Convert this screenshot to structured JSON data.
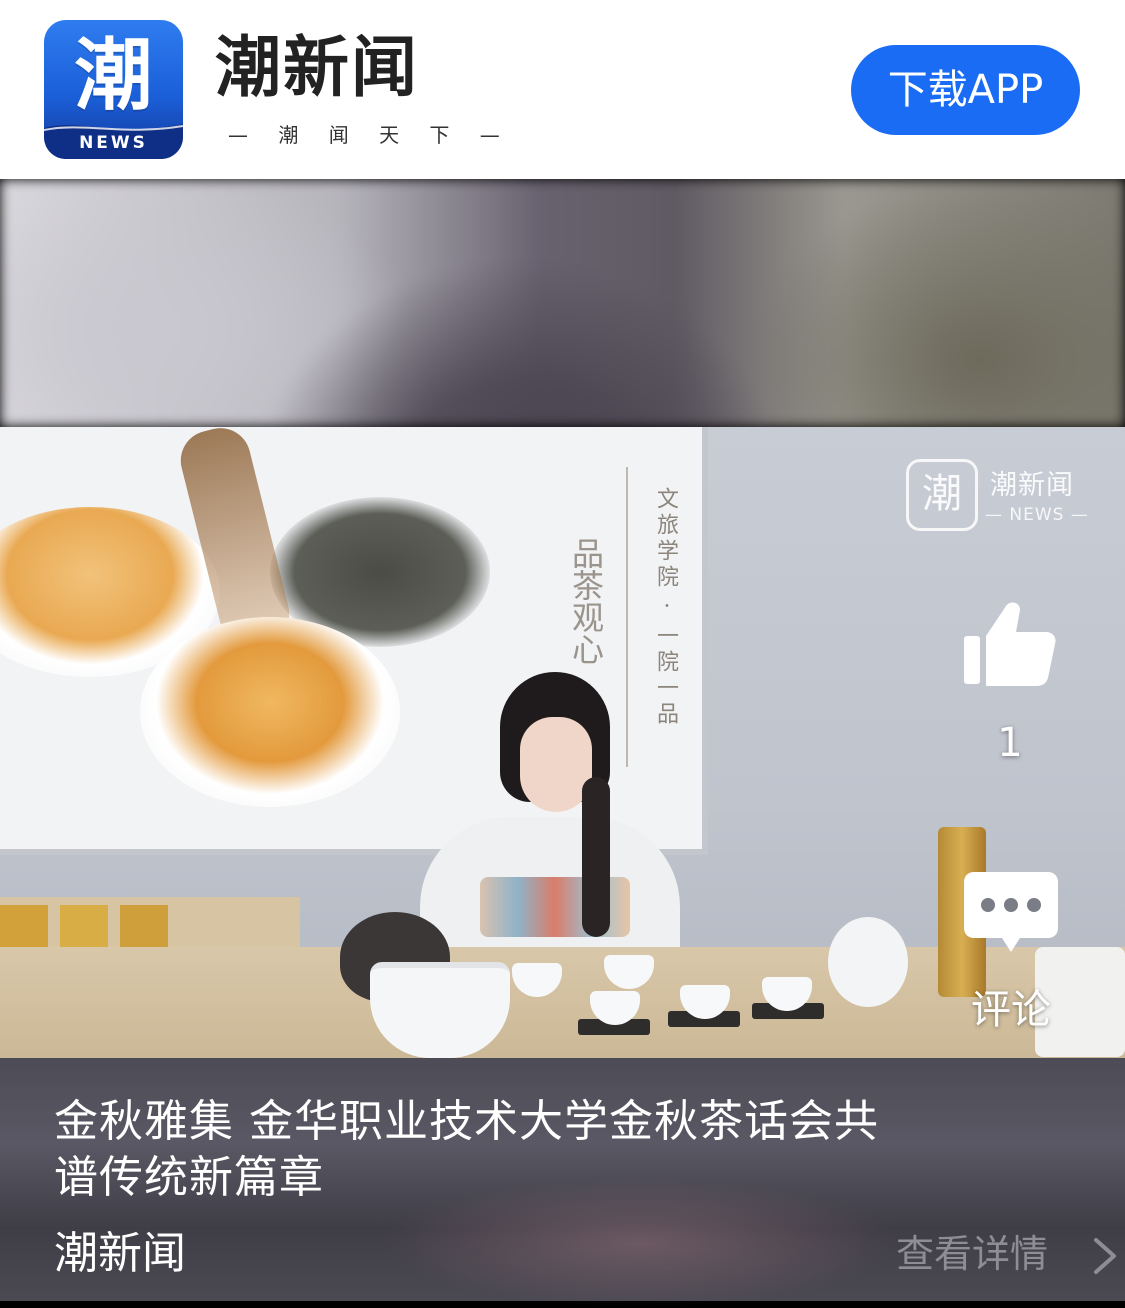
{
  "header": {
    "logo_char": "潮",
    "logo_sub": "NEWS",
    "app_name": "潮新闻",
    "slogan": "— 潮 闻 天 下 —",
    "download_label": "下载APP"
  },
  "video": {
    "screen_text_main": "品茶观心",
    "screen_text_side": "文旅学院 · 一院一品",
    "watermark": {
      "char": "潮",
      "name": "潮新闻",
      "sub": "— NEWS —"
    },
    "like_count": "1",
    "comment_label": "评论",
    "icons": {
      "like": "thumbs-up-icon",
      "comment": "chat-bubble-icon"
    }
  },
  "article": {
    "title": "金秋雅集 金华职业技术大学金秋茶话会共谱传统新篇章",
    "source": "潮新闻",
    "detail_label": "查看详情"
  },
  "colors": {
    "accent": "#1a6cf5",
    "header_bg": "#ffffff",
    "detail_text": "#8e8c94"
  }
}
